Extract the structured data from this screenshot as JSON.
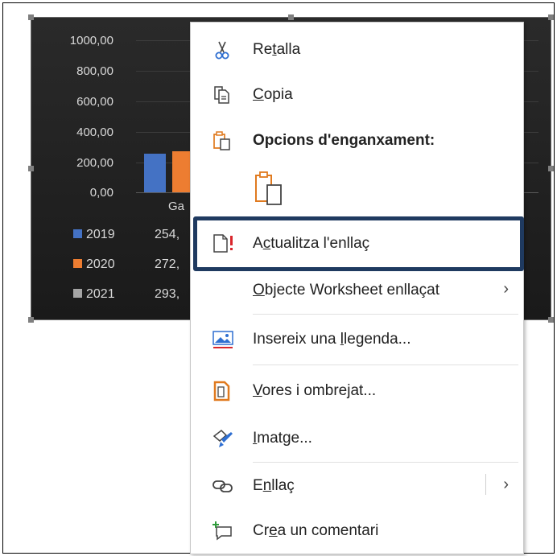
{
  "chart": {
    "y_ticks": [
      "1000,00",
      "800,00",
      "600,00",
      "400,00",
      "200,00",
      "0,00"
    ],
    "category_label": "Ga",
    "legend": [
      {
        "year": "2019",
        "value": "254,",
        "color": "#4472c4"
      },
      {
        "year": "2020",
        "value": "272,",
        "color": "#ed7d31"
      },
      {
        "year": "2021",
        "value": "293,",
        "color": "#a5a5a5"
      }
    ]
  },
  "menu": {
    "cut": {
      "pre": "Re",
      "acc": "t",
      "post": "alla"
    },
    "copy": {
      "pre": "",
      "acc": "C",
      "post": "opia"
    },
    "paste_options": "Opcions d'enganxament:",
    "update_link": {
      "pre": "A",
      "acc": "c",
      "post": "tualitza l'enllaç"
    },
    "linked_object": {
      "pre": "",
      "acc": "O",
      "post": "bjecte Worksheet enllaçat"
    },
    "insert_caption": {
      "pre": "Insereix una ",
      "acc": "l",
      "post": "legenda..."
    },
    "borders": {
      "pre": "",
      "acc": "V",
      "post": "ores i ombrejat..."
    },
    "image": {
      "pre": "",
      "acc": "I",
      "post": "matge..."
    },
    "link": {
      "pre": "E",
      "acc": "n",
      "post": "llaç"
    },
    "comment": {
      "pre": "Cr",
      "acc": "e",
      "post": "a un comentari"
    },
    "chevron": "›"
  },
  "colors": {
    "highlight": "#1f3a60",
    "accent_orange": "#e07a1f",
    "accent_red": "#d9262c"
  }
}
